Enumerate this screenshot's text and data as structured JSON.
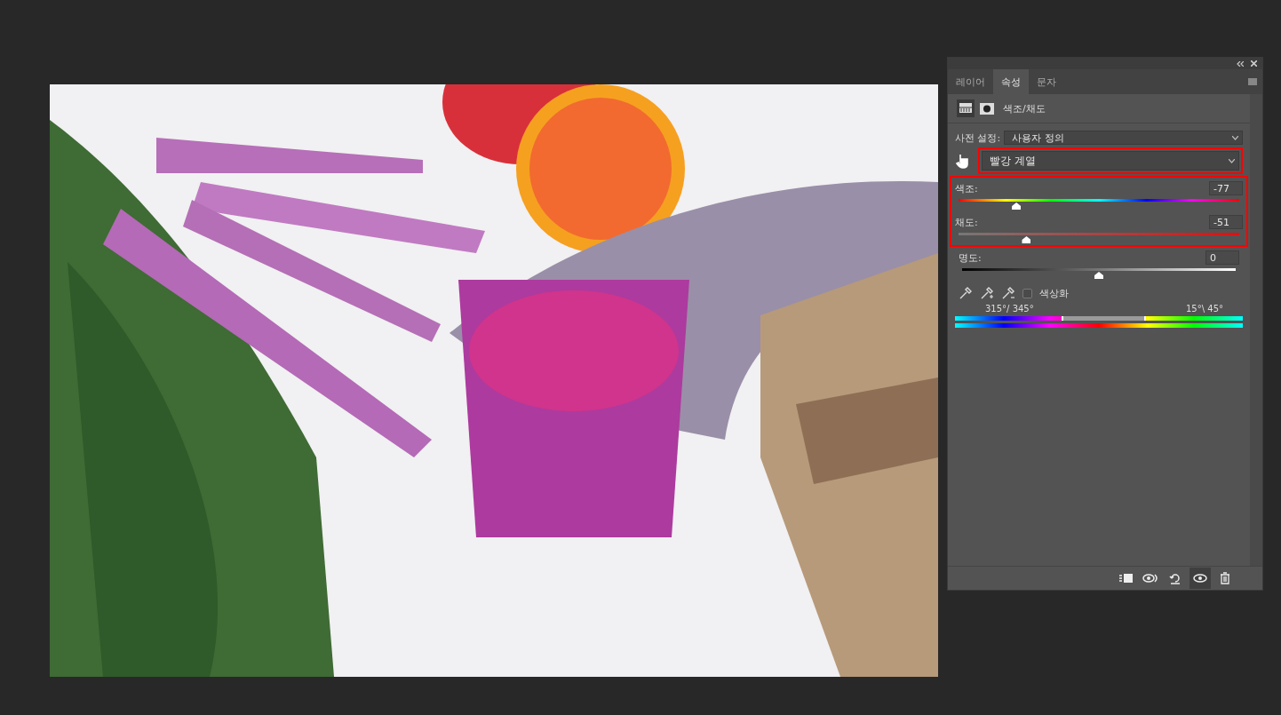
{
  "panel": {
    "tabs": [
      {
        "label": "레이어",
        "selected": false
      },
      {
        "label": "속성",
        "selected": true
      },
      {
        "label": "문자",
        "selected": false
      }
    ],
    "title": "색조/채도",
    "preset": {
      "label": "사전 설정:",
      "value": "사용자 정의"
    },
    "channel": {
      "value": "빨강 계열",
      "highlighted": true
    },
    "sliders": [
      {
        "kind": "hue",
        "label": "색조:",
        "value": "-77",
        "level": 0.206,
        "highlighted": true
      },
      {
        "kind": "saturation",
        "label": "채도:",
        "value": "-51",
        "level": 0.242,
        "highlighted": true
      },
      {
        "kind": "lightness",
        "label": "명도:",
        "value": "0",
        "level": 0.5,
        "highlighted": false
      }
    ],
    "colorize": {
      "label": "색상화",
      "checked": false
    },
    "range": {
      "left": "315°/ 345°",
      "right": "15°\\ 45°"
    },
    "toolbar": [
      {
        "kind": "clip",
        "selected": false
      },
      {
        "kind": "previous",
        "selected": false
      },
      {
        "kind": "reset",
        "selected": false
      },
      {
        "kind": "visibility",
        "selected": true
      },
      {
        "kind": "delete",
        "selected": false
      }
    ]
  }
}
